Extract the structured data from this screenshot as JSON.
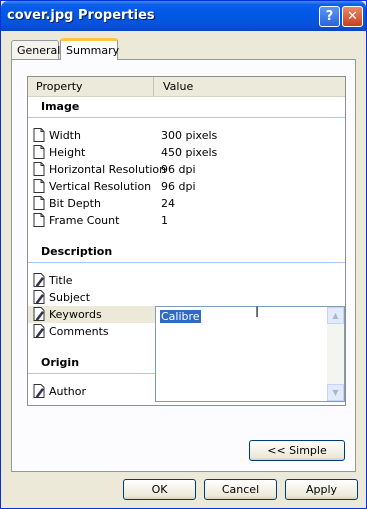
{
  "window": {
    "title": "cover.jpg Properties"
  },
  "tabs": [
    {
      "label": "General"
    },
    {
      "label": "Summary"
    }
  ],
  "grid": {
    "header": {
      "property": "Property",
      "value": "Value"
    },
    "sections": [
      {
        "label": "Image"
      },
      {
        "label": "Description"
      },
      {
        "label": "Origin"
      }
    ],
    "image_rows": [
      {
        "name": "Width",
        "value": "300 pixels"
      },
      {
        "name": "Height",
        "value": "450 pixels"
      },
      {
        "name": "Horizontal Resolution",
        "value": "96 dpi"
      },
      {
        "name": "Vertical Resolution",
        "value": "96 dpi"
      },
      {
        "name": "Bit Depth",
        "value": "24"
      },
      {
        "name": "Frame Count",
        "value": "1"
      }
    ],
    "description_rows": [
      {
        "name": "Title"
      },
      {
        "name": "Subject"
      },
      {
        "name": "Keywords"
      },
      {
        "name": "Comments"
      }
    ],
    "origin_rows": [
      {
        "name": "Author"
      }
    ]
  },
  "editor": {
    "value": "Calibre"
  },
  "buttons": {
    "simple": "<< Simple",
    "ok": "OK",
    "cancel": "Cancel",
    "apply": "Apply"
  }
}
